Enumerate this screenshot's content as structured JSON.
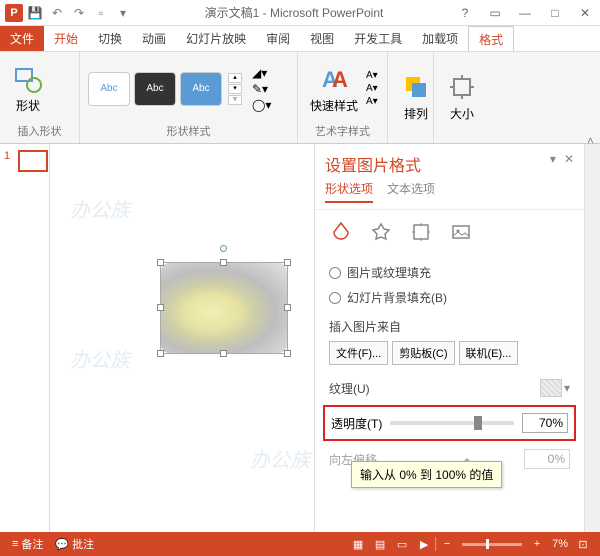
{
  "title": "演示文稿1 - Microsoft PowerPoint",
  "tabs": {
    "file": "文件",
    "home": "开始",
    "switch": "切换",
    "anim": "动画",
    "slideshow": "幻灯片放映",
    "review": "审阅",
    "view": "视图",
    "dev": "开发工具",
    "addin": "加载项",
    "format": "格式"
  },
  "ribbon": {
    "insertShape": {
      "btn": "形状",
      "label": "插入形状"
    },
    "shapeStyles": {
      "thumb": "Abc",
      "label": "形状样式"
    },
    "wordArt": {
      "btn": "快速样式",
      "label": "艺术字样式"
    },
    "arrange": {
      "btn": "排列"
    },
    "size": {
      "btn": "大小"
    }
  },
  "slide": {
    "num": "1"
  },
  "pane": {
    "title": "设置图片格式",
    "tab_shape": "形状选项",
    "tab_text": "文本选项",
    "opt_pic": "图片或纹理填充",
    "opt_bg": "幻灯片背景填充(B)",
    "insert_from": "插入图片来自",
    "btn_file": "文件(F)...",
    "btn_clip": "剪贴板(C)",
    "btn_online": "联机(E)...",
    "texture": "纹理(U)",
    "transparency": "透明度(T)",
    "trans_val": "70%",
    "offset": "向左偏移",
    "offset_val": "0%",
    "tooltip": "输入从 0% 到 100% 的值"
  },
  "status": {
    "notes": "备注",
    "comments": "批注",
    "zoom": "7%"
  }
}
